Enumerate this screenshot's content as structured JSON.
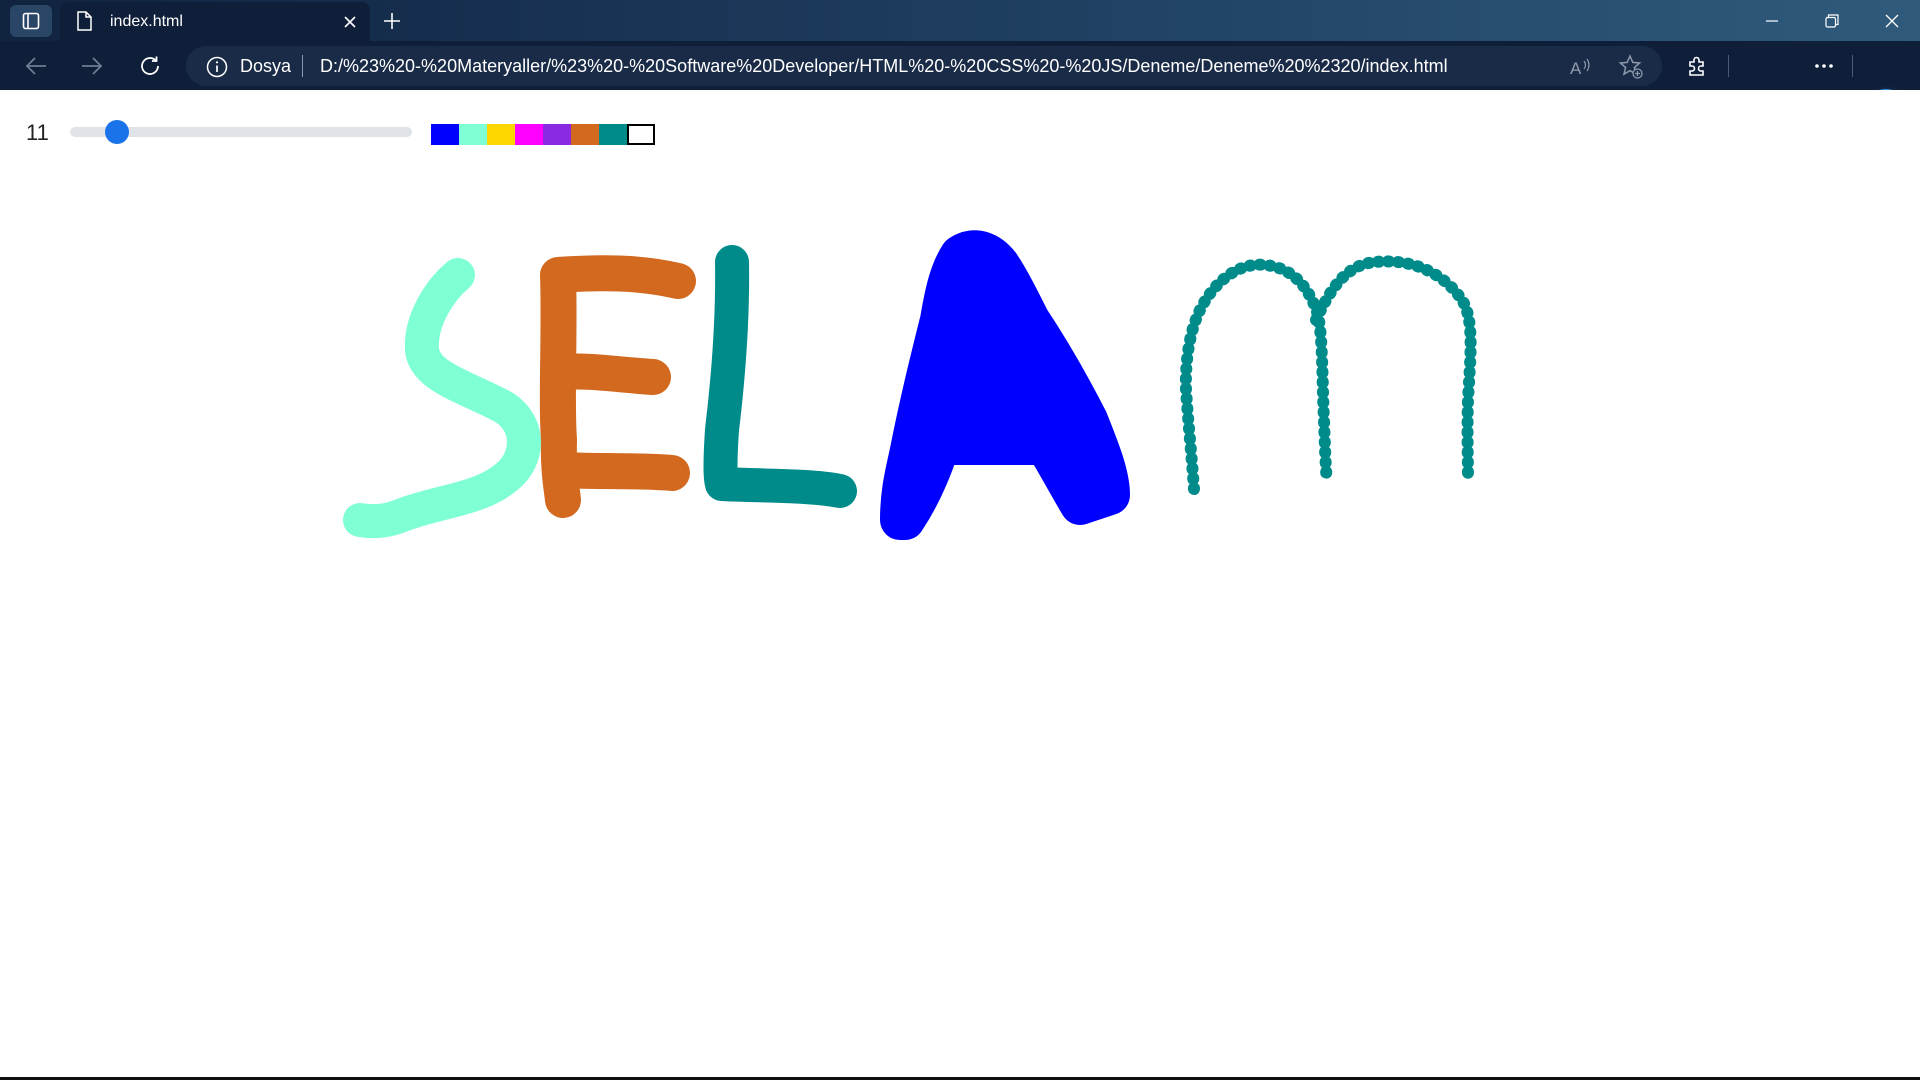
{
  "window": {
    "tab_title": "index.html",
    "icons": [
      "tab-actions-icon",
      "file-icon",
      "close-icon",
      "plus-icon",
      "minimize-icon",
      "restore-icon",
      "close-window-icon"
    ]
  },
  "toolbar": {
    "site_label": "Dosya",
    "url": "D:/%23%20-%20Materyaller/%23%20-%20Software%20Developer/HTML%20-%20CSS%20-%20JS/Deneme/Deneme%20%2320/index.html",
    "icons": [
      "back-icon",
      "forward-icon",
      "refresh-icon",
      "info-icon",
      "read-aloud-icon",
      "add-favorite-icon",
      "extensions-icon",
      "profile-avatar",
      "more-icon",
      "copilot-icon"
    ]
  },
  "drawing_app": {
    "brush_size": "11",
    "brush_size_fraction": 0.11,
    "palette": [
      "#0000ff",
      "#7fffd4",
      "#ffd700",
      "#ff00ff",
      "#8a2be2",
      "#d2691e",
      "#008b8b",
      "#ffffff"
    ],
    "selected_color": "#008b8b"
  },
  "canvas": {
    "strokes": [
      {
        "letter": "S",
        "color": "#7fffd4"
      },
      {
        "letter": "E",
        "color": "#d2691e"
      },
      {
        "letter": "L",
        "color": "#008b8b"
      },
      {
        "letter": "A",
        "color": "#0000ff"
      },
      {
        "letter": "m",
        "color": "#008b8b"
      }
    ]
  }
}
